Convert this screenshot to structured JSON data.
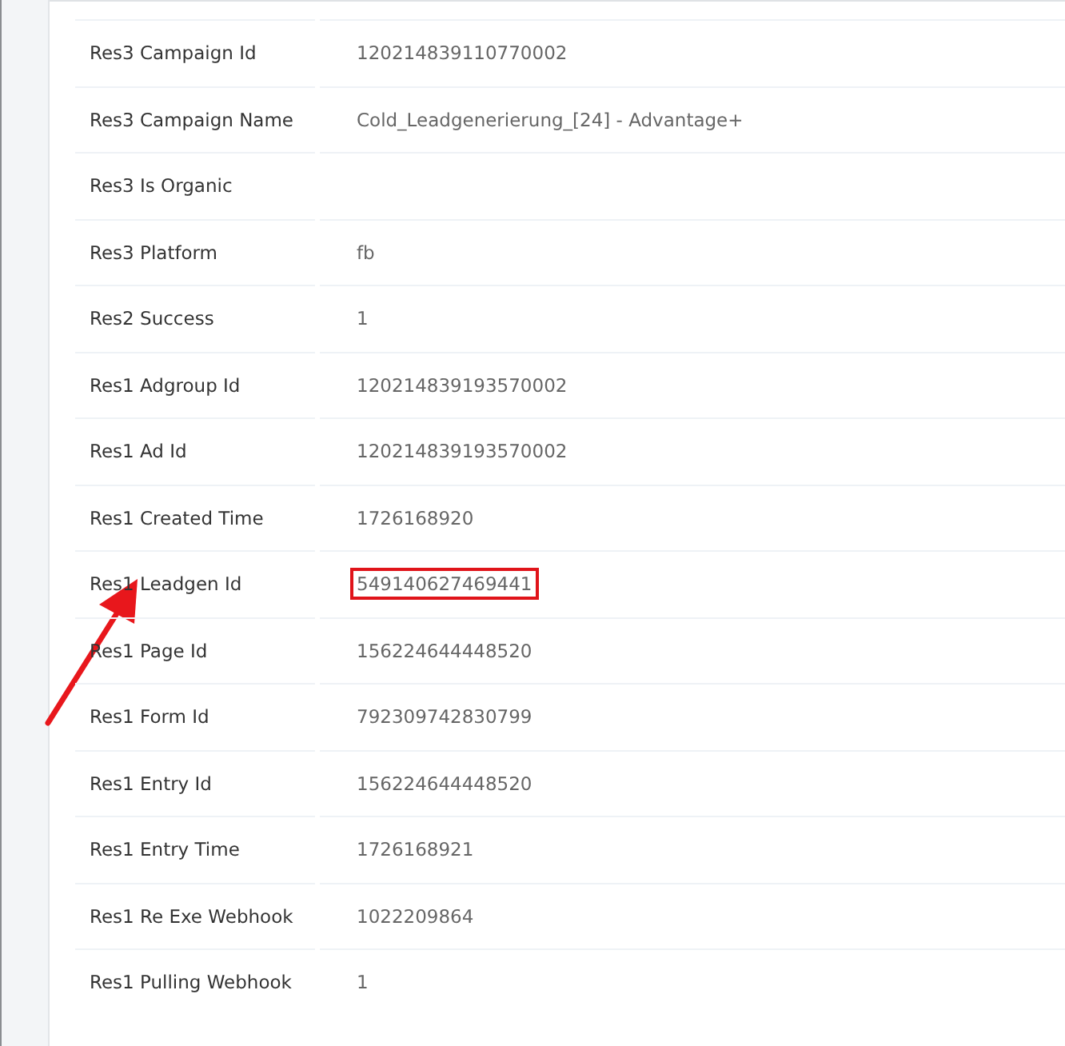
{
  "fields": [
    {
      "label": "Res3 Campaign Id",
      "value": "120214839110770002",
      "highlighted": false
    },
    {
      "label": "Res3 Campaign Name",
      "value": "Cold_Leadgenerierung_[24] - Advantage+",
      "highlighted": false
    },
    {
      "label": "Res3 Is Organic",
      "highlighted": false
    },
    {
      "label": "Res3 Platform",
      "value": "fb",
      "highlighted": false
    },
    {
      "label": "Res2 Success",
      "value": "1",
      "highlighted": false
    },
    {
      "label": "Res1 Adgroup Id",
      "value": "120214839193570002",
      "highlighted": false
    },
    {
      "label": "Res1 Ad Id",
      "value": "120214839193570002",
      "highlighted": false
    },
    {
      "label": "Res1 Created Time",
      "value": "1726168920",
      "highlighted": false
    },
    {
      "label": "Res1 Leadgen Id",
      "value": "549140627469441",
      "highlighted": true
    },
    {
      "label": "Res1 Page Id",
      "value": "156224644448520",
      "highlighted": false
    },
    {
      "label": "Res1 Form Id",
      "value": "792309742830799",
      "highlighted": false
    },
    {
      "label": "Res1 Entry Id",
      "value": "156224644448520",
      "highlighted": false
    },
    {
      "label": "Res1 Entry Time",
      "value": "1726168921",
      "highlighted": false
    },
    {
      "label": "Res1 Re Exe Webhook",
      "value": "1022209864",
      "highlighted": false
    },
    {
      "label": "Res1 Pulling Webhook",
      "value": "1",
      "highlighted": false
    }
  ]
}
